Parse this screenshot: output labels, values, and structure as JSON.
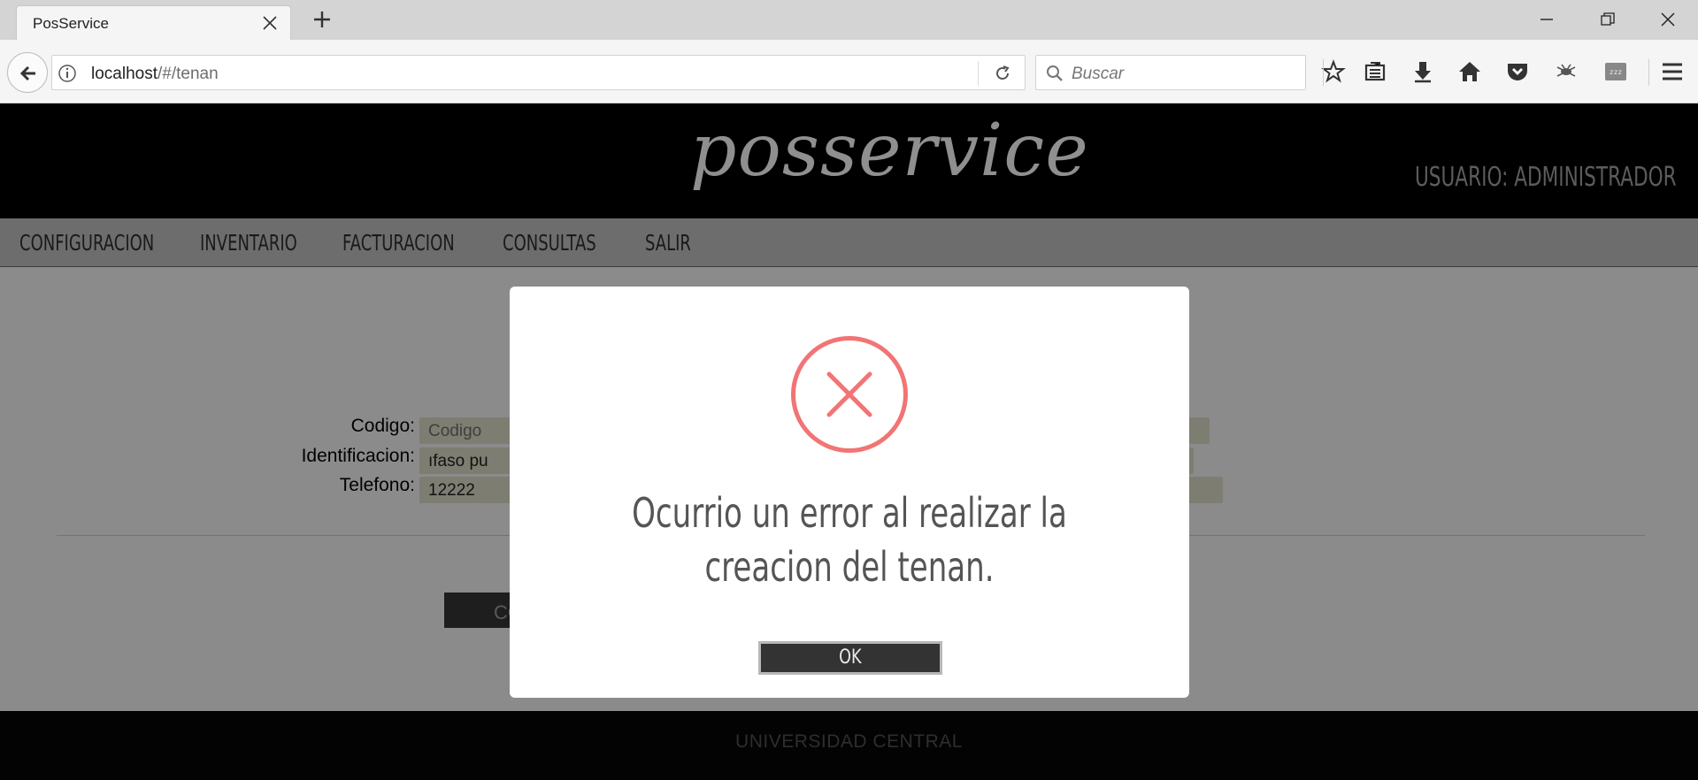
{
  "browser": {
    "tab_title": "PosService",
    "url_host": "localhost",
    "url_path": "/#/tenan",
    "search_placeholder": "Buscar"
  },
  "site": {
    "logo": "posservice",
    "user_label": "USUARIO: ADMINISTRADOR",
    "menu": [
      {
        "label": "CONFIGURACION"
      },
      {
        "label": "INVENTARIO"
      },
      {
        "label": "FACTURACION"
      },
      {
        "label": "CONSULTAS"
      },
      {
        "label": "SALIR"
      }
    ],
    "form": {
      "codigo_label": "Codigo:",
      "codigo_placeholder": "Codigo",
      "identificacion_label": "Identificacion:",
      "identificacion_value": "ıfaso pu",
      "telefono_label": "Telefono:",
      "telefono_value": "12222",
      "button_partial": "CO"
    },
    "footer": "UNIVERSIDAD CENTRAL"
  },
  "dialog": {
    "icon": "error-x-icon",
    "message": "Ocurrio un error al realizar la creacion del tenan.",
    "ok_label": "OK"
  },
  "colors": {
    "error": "#f27474",
    "header_bg": "#000000",
    "menu_bg": "#6d6d6d"
  }
}
